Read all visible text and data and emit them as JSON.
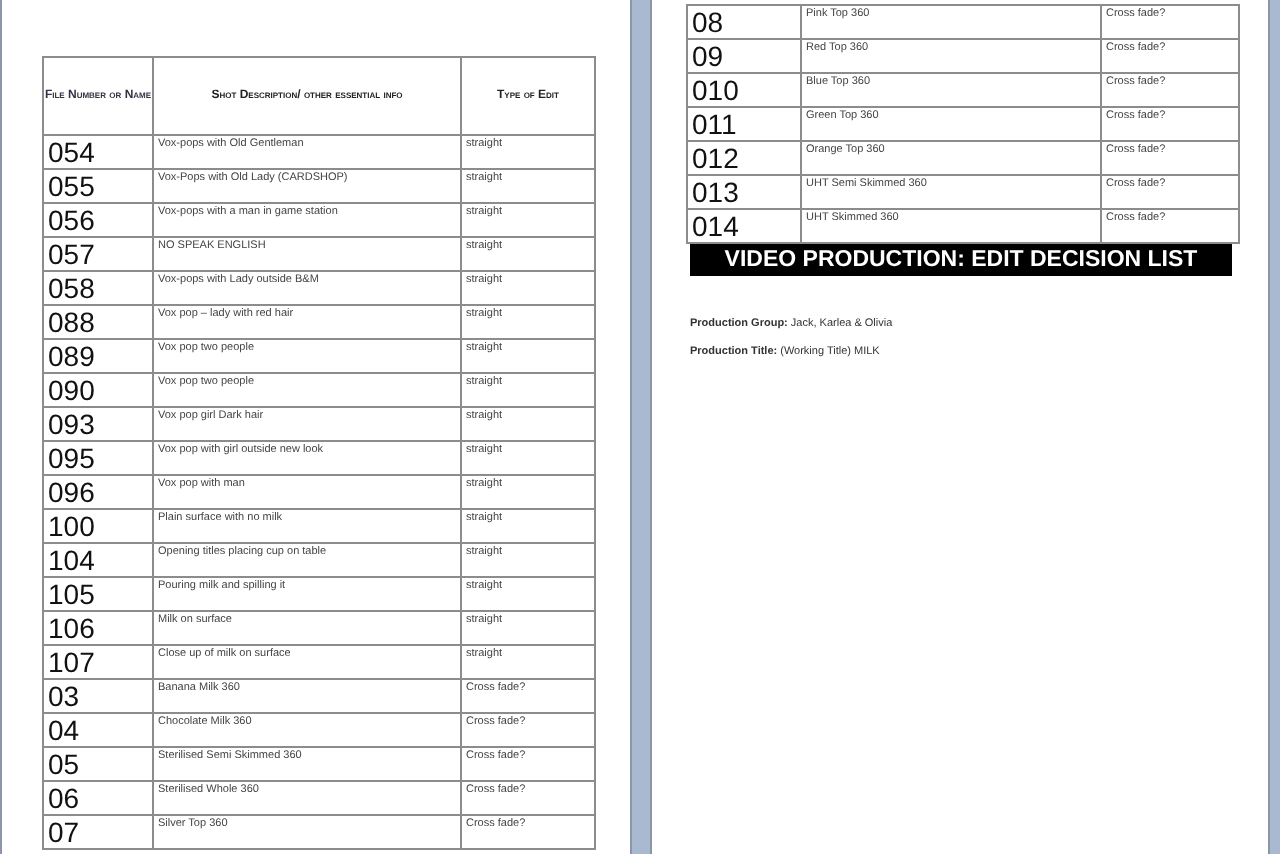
{
  "pages": [
    {
      "table": {
        "columns": [
          "File Number or Name",
          "Shot Description/ other essential info",
          "Type of Edit"
        ],
        "rows": [
          {
            "file": "054",
            "description": "Vox-pops with Old Gentleman",
            "edit": "straight"
          },
          {
            "file": "055",
            "description": "Vox-Pops with Old Lady (CARDSHOP)",
            "edit": "straight"
          },
          {
            "file": "056",
            "description": "Vox-pops with a man in game station",
            "edit": "straight"
          },
          {
            "file": "057",
            "description": "NO SPEAK ENGLISH",
            "edit": "straight"
          },
          {
            "file": "058",
            "description": "Vox-pops with Lady outside B&M",
            "edit": "straight"
          },
          {
            "file": "088",
            "description": "Vox pop – lady with red hair",
            "edit": "straight"
          },
          {
            "file": "089",
            "description": "Vox pop two people",
            "edit": "straight"
          },
          {
            "file": "090",
            "description": "Vox pop two people",
            "edit": "straight"
          },
          {
            "file": "093",
            "description": "Vox pop girl Dark hair",
            "edit": "straight"
          },
          {
            "file": "095",
            "description": "Vox pop with girl outside new look",
            "edit": "straight"
          },
          {
            "file": "096",
            "description": "Vox pop with man",
            "edit": "straight"
          },
          {
            "file": "100",
            "description": "Plain surface with no milk",
            "edit": "straight"
          },
          {
            "file": "104",
            "description": "Opening titles placing cup on table",
            "edit": "straight"
          },
          {
            "file": "105",
            "description": "Pouring milk and spilling it",
            "edit": "straight"
          },
          {
            "file": "106",
            "description": "Milk on surface",
            "edit": "straight"
          },
          {
            "file": "107",
            "description": "Close up of milk on surface",
            "edit": "straight"
          },
          {
            "file": "03",
            "description": "Banana Milk 360",
            "edit": "Cross fade?"
          },
          {
            "file": "04",
            "description": "Chocolate Milk 360",
            "edit": "Cross fade?"
          },
          {
            "file": "05",
            "description": "Sterilised Semi Skimmed 360",
            "edit": "Cross fade?"
          },
          {
            "file": "06",
            "description": "Sterilised Whole 360",
            "edit": "Cross fade?"
          },
          {
            "file": "07",
            "description": "Silver Top 360",
            "edit": "Cross fade?"
          }
        ]
      }
    },
    {
      "table": {
        "rows": [
          {
            "file": "08",
            "description": "Pink Top 360",
            "edit": "Cross fade?"
          },
          {
            "file": "09",
            "description": "Red Top 360",
            "edit": "Cross fade?"
          },
          {
            "file": "010",
            "description": "Blue Top 360",
            "edit": "Cross fade?"
          },
          {
            "file": "011",
            "description": "Green Top 360",
            "edit": "Cross fade?"
          },
          {
            "file": "012",
            "description": "Orange Top 360",
            "edit": "Cross fade?"
          },
          {
            "file": "013",
            "description": "UHT Semi Skimmed 360",
            "edit": "Cross fade?"
          },
          {
            "file": "014",
            "description": "UHT Skimmed 360",
            "edit": "Cross fade?"
          }
        ]
      },
      "banner": "VIDEO PRODUCTION: EDIT DECISION LIST",
      "lines": [
        "**Production  Group:**  Jack, Karlea & Olivia",
        "**Production  Title:** (Working Title) MILK"
      ]
    }
  ]
}
